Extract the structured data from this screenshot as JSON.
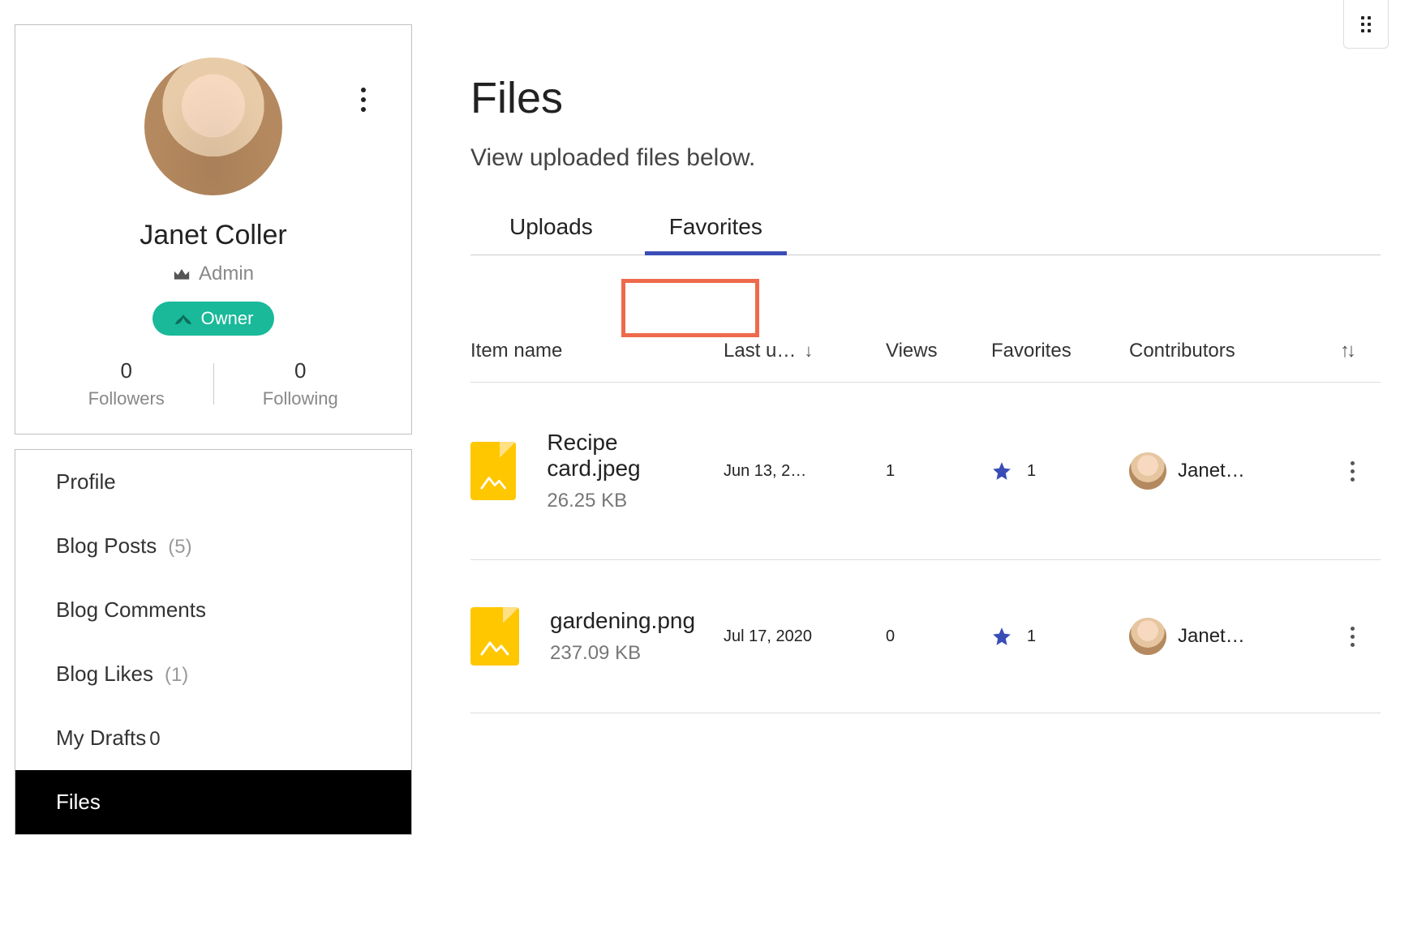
{
  "profile": {
    "name": "Janet Coller",
    "role": "Admin",
    "badge": "Owner",
    "followers_count": "0",
    "followers_label": "Followers",
    "following_count": "0",
    "following_label": "Following"
  },
  "nav": {
    "items": [
      {
        "label": "Profile",
        "count": ""
      },
      {
        "label": "Blog Posts",
        "count": "(5)"
      },
      {
        "label": "Blog Comments",
        "count": ""
      },
      {
        "label": "Blog Likes",
        "count": "(1)"
      },
      {
        "label": "My Drafts",
        "count": "0"
      },
      {
        "label": "Files",
        "count": ""
      }
    ],
    "active_index": 5
  },
  "page": {
    "title": "Files",
    "subtitle": "View uploaded files below.",
    "tabs": {
      "uploads": "Uploads",
      "favorites": "Favorites",
      "active": "favorites"
    }
  },
  "table": {
    "columns": {
      "item": "Item name",
      "last_updated": "Last u…",
      "views": "Views",
      "favorites": "Favorites",
      "contributors": "Contributors"
    },
    "rows": [
      {
        "name": "Recipe card.jpeg",
        "size": "26.25 KB",
        "last_updated": "Jun 13, 2…",
        "views": "1",
        "favorites": "1",
        "contributor": "Janet…"
      },
      {
        "name": "gardening.png",
        "size": "237.09 KB",
        "last_updated": "Jul 17, 2020",
        "views": "0",
        "favorites": "1",
        "contributor": "Janet…"
      }
    ]
  }
}
